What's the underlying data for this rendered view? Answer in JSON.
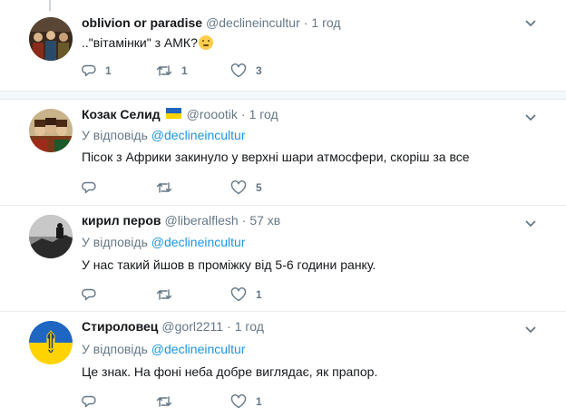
{
  "tweets": [
    {
      "name": "oblivion or paradise",
      "handle": "@declineincultur",
      "dot": "·",
      "time": "1 год",
      "text": "..\"вітамінки\" з АМК?",
      "has_emoji": true,
      "emoji_icon": "thinking-face-icon",
      "actions": {
        "reply": "1",
        "retweet": "1",
        "like": "3"
      }
    },
    {
      "name": "Козак Селид",
      "handle": "@roootik",
      "dot": "·",
      "time": "1 год",
      "has_flag": true,
      "flag_colors": [
        "#1f66c2",
        "#ffd300"
      ],
      "reply_label": "У відповідь",
      "reply_handle": "@declineincultur",
      "text": "Пісок з Африки закинуло у верхні шари атмосфери, скоріш за все",
      "actions": {
        "reply": "",
        "retweet": "",
        "like": "5"
      }
    },
    {
      "name": "кирил перов",
      "handle": "@liberalflesh",
      "dot": "·",
      "time": "57 хв",
      "reply_label": "У відповідь",
      "reply_handle": "@declineincultur",
      "text": "У нас такий йшов в проміжку від 5-6 години ранку.",
      "actions": {
        "reply": "",
        "retweet": "",
        "like": "1"
      }
    },
    {
      "name": "Стироловец",
      "handle": "@gorl2211",
      "dot": "·",
      "time": "1 год",
      "reply_label": "У відповідь",
      "reply_handle": "@declineincultur",
      "text": "Це знак. На фоні неба добре виглядає, як прапор.",
      "actions": {
        "reply": "",
        "retweet": "",
        "like": "1"
      }
    }
  ],
  "colors": {
    "link": "#1b95e0",
    "secondary": "#657786",
    "icon": "#657786"
  }
}
